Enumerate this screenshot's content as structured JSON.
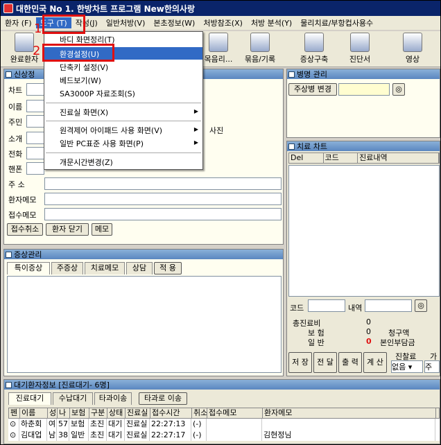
{
  "title": "대한민국 No 1. 한방차트 프로그램 New한의사랑",
  "menu": [
    "환자 (F)",
    "도구 (T)",
    "작성(J)",
    "일반처방(V)",
    "본초정보(W)",
    "처방참조(X)",
    "처방 분석(Y)",
    "물리치료/부항컵사용수"
  ],
  "toolbar": [
    "완료환자",
    "목음리...",
    "묶음/기록",
    "증상구축",
    "진단서",
    "영상"
  ],
  "dropdown": {
    "items": [
      "바디 화면정리(T)",
      "환경설정(U)",
      "단축키 설정(V)",
      "베드보기(W)",
      "SA3000P 자료조회(S)",
      "진료실 화면(X)",
      "원격제어 아이패드 사용 화면(V)",
      "일반 PC표준 사용 화면(P)",
      "개문시간변경(Z)"
    ]
  },
  "annotations": {
    "one": "1",
    "two": "2"
  },
  "patient": {
    "header": "신상정",
    "labels": [
      "차트",
      "이름",
      "주민",
      "소개",
      "전화",
      "핸폰",
      "주  소",
      "환자메모",
      "접수메모"
    ],
    "photo": "사진",
    "buttons": [
      "접수취소",
      "환자 닫기",
      "메모"
    ]
  },
  "disease": {
    "header": "병명 관리",
    "button": "주상병 변경"
  },
  "treat": {
    "header": "치료 차트",
    "cols": [
      "Del",
      "코드",
      "진료내역"
    ],
    "code_label": "코드",
    "content_label": "내역"
  },
  "summary": {
    "labels": [
      "총진료비",
      "보  험",
      "일  반"
    ],
    "values": [
      "0",
      "0",
      "0"
    ],
    "right_labels": [
      "청구액",
      "본인부담금"
    ],
    "buttons": [
      "저 장",
      "전 달",
      "출 력",
      "계 산"
    ],
    "fee_label": "진찰료",
    "fee_select": "없음",
    "extra": "가",
    "extra2": "주간"
  },
  "symptom": {
    "header": "증상관리",
    "tabs": [
      "특이증상",
      "주증상",
      "치료메모",
      "상담"
    ],
    "apply": "적 용"
  },
  "queue": {
    "header": "대기환자정보 [진료대기- 6명]",
    "tabs": [
      "진료대기",
      "수납대기",
      "타과이송"
    ],
    "transfer": "타과로 이송",
    "cols": [
      "펜",
      "이름",
      "성",
      "나",
      "보험",
      "구분",
      "상태",
      "진료실",
      "접수시간",
      "취소",
      "접수메모",
      "환자메모"
    ],
    "rows": [
      [
        "⊙",
        "하춘회",
        "여",
        "57",
        "보험",
        "초진",
        "대기",
        "진료실",
        "22:27:13",
        "(-)",
        "",
        ""
      ],
      [
        "⊙",
        "김대업",
        "남",
        "38",
        "일반",
        "초진",
        "대기",
        "진료실",
        "22:27:17",
        "(-)",
        "",
        "김현정님"
      ]
    ]
  }
}
